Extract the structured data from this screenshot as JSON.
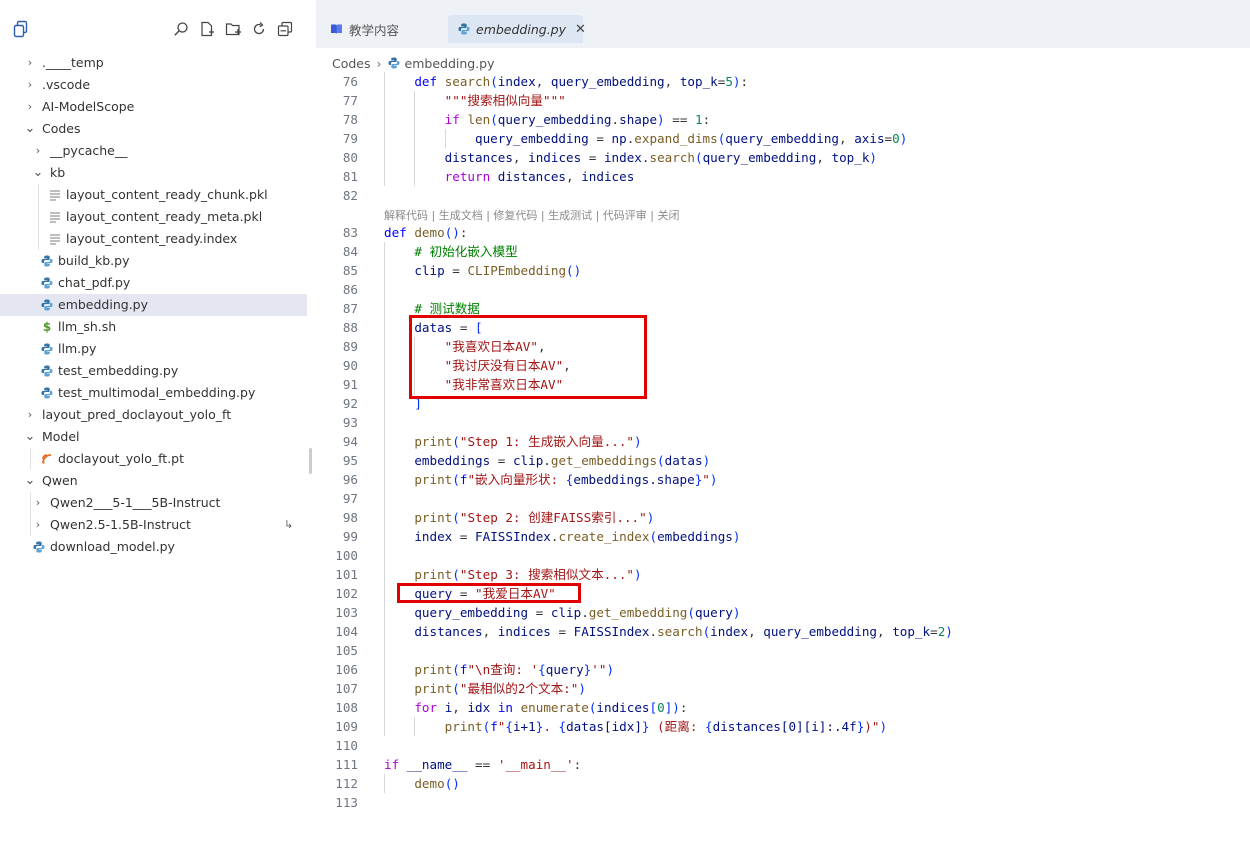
{
  "sidebar": {
    "toolbar": {
      "files_icon": "files-icon",
      "search_icon": "search-icon",
      "new_file_icon": "new-file-icon",
      "new_folder_icon": "new-folder-icon",
      "refresh_icon": "refresh-icon",
      "collapse_icon": "collapse-all-icon"
    },
    "tree": [
      {
        "label": ".____temp",
        "type": "folder",
        "expanded": false,
        "depth": 0
      },
      {
        "label": ".vscode",
        "type": "folder",
        "expanded": false,
        "depth": 0
      },
      {
        "label": "AI-ModelScope",
        "type": "folder",
        "expanded": false,
        "depth": 0
      },
      {
        "label": "Codes",
        "type": "folder",
        "expanded": true,
        "depth": 0
      },
      {
        "label": "__pycache__",
        "type": "folder",
        "expanded": false,
        "depth": 1
      },
      {
        "label": "kb",
        "type": "folder",
        "expanded": true,
        "depth": 1
      },
      {
        "label": "layout_content_ready_chunk.pkl",
        "type": "text-file",
        "depth": 2
      },
      {
        "label": "layout_content_ready_meta.pkl",
        "type": "text-file",
        "depth": 2
      },
      {
        "label": "layout_content_ready.index",
        "type": "text-file",
        "depth": 2
      },
      {
        "label": "build_kb.py",
        "type": "python-file",
        "depth": 1
      },
      {
        "label": "chat_pdf.py",
        "type": "python-file",
        "depth": 1
      },
      {
        "label": "embedding.py",
        "type": "python-file",
        "depth": 1,
        "selected": true
      },
      {
        "label": "llm_sh.sh",
        "type": "shell-file",
        "depth": 1
      },
      {
        "label": "llm.py",
        "type": "python-file",
        "depth": 1
      },
      {
        "label": "test_embedding.py",
        "type": "python-file",
        "depth": 1
      },
      {
        "label": "test_multimodal_embedding.py",
        "type": "python-file",
        "depth": 1
      },
      {
        "label": "layout_pred_doclayout_yolo_ft",
        "type": "folder",
        "expanded": false,
        "depth": 0
      },
      {
        "label": "Model",
        "type": "folder",
        "expanded": true,
        "depth": 0
      },
      {
        "label": "doclayout_yolo_ft.pt",
        "type": "model-file",
        "depth": 1
      },
      {
        "label": "Qwen",
        "type": "folder",
        "expanded": true,
        "depth": 0
      },
      {
        "label": "Qwen2___5-1___5B-Instruct",
        "type": "folder",
        "expanded": false,
        "depth": 1
      },
      {
        "label": "Qwen2.5-1.5B-Instruct",
        "type": "folder",
        "expanded": false,
        "depth": 1,
        "symlink": true
      },
      {
        "label": "download_model.py",
        "type": "python-file",
        "depth": 0
      }
    ]
  },
  "editor": {
    "tabs": [
      {
        "label": "教学内容",
        "icon": "book-icon",
        "active": false
      },
      {
        "label": "embedding.py",
        "icon": "python-icon",
        "active": true,
        "close_icon": "close-icon"
      }
    ],
    "breadcrumb": {
      "folder": "Codes",
      "file": "embedding.py"
    },
    "codelens": "解释代码 | 生成文档 | 修复代码 | 生成测试 | 代码评审 | 关闭",
    "lines": [
      {
        "n": "76",
        "code": "    def search(index, query_embedding, top_k=5):"
      },
      {
        "n": "77",
        "code": "        \"\"\"搜索相似向量\"\"\""
      },
      {
        "n": "78",
        "code": "        if len(query_embedding.shape) == 1:"
      },
      {
        "n": "79",
        "code": "            query_embedding = np.expand_dims(query_embedding, axis=0)"
      },
      {
        "n": "80",
        "code": "        distances, indices = index.search(query_embedding, top_k)"
      },
      {
        "n": "81",
        "code": "        return distances, indices"
      },
      {
        "n": "82",
        "code": ""
      },
      {
        "n": "83",
        "code": "def demo():"
      },
      {
        "n": "84",
        "code": "    # 初始化嵌入模型"
      },
      {
        "n": "85",
        "code": "    clip = CLIPEmbedding()"
      },
      {
        "n": "86",
        "code": ""
      },
      {
        "n": "87",
        "code": "    # 测试数据"
      },
      {
        "n": "88",
        "code": "    datas = ["
      },
      {
        "n": "89",
        "code": "        \"我喜欢日本AV\","
      },
      {
        "n": "90",
        "code": "        \"我讨厌没有日本AV\","
      },
      {
        "n": "91",
        "code": "        \"我非常喜欢日本AV\""
      },
      {
        "n": "92",
        "code": "    ]"
      },
      {
        "n": "93",
        "code": ""
      },
      {
        "n": "94",
        "code": "    print(\"Step 1: 生成嵌入向量...\")"
      },
      {
        "n": "95",
        "code": "    embeddings = clip.get_embeddings(datas)"
      },
      {
        "n": "96",
        "code": "    print(f\"嵌入向量形状: {embeddings.shape}\")"
      },
      {
        "n": "97",
        "code": ""
      },
      {
        "n": "98",
        "code": "    print(\"Step 2: 创建FAISS索引...\")"
      },
      {
        "n": "99",
        "code": "    index = FAISSIndex.create_index(embeddings)"
      },
      {
        "n": "100",
        "code": ""
      },
      {
        "n": "101",
        "code": "    print(\"Step 3: 搜索相似文本...\")"
      },
      {
        "n": "102",
        "code": "    query = \"我爱日本AV\""
      },
      {
        "n": "103",
        "code": "    query_embedding = clip.get_embedding(query)"
      },
      {
        "n": "104",
        "code": "    distances, indices = FAISSIndex.search(index, query_embedding, top_k=2)"
      },
      {
        "n": "105",
        "code": ""
      },
      {
        "n": "106",
        "code": "    print(f\"\\n查询: '{query}'\")"
      },
      {
        "n": "107",
        "code": "    print(\"最相似的2个文本:\")"
      },
      {
        "n": "108",
        "code": "    for i, idx in enumerate(indices[0]):"
      },
      {
        "n": "109",
        "code": "        print(f\"{i+1}. {datas[idx]} (距离: {distances[0][i]:.4f})\")"
      },
      {
        "n": "110",
        "code": ""
      },
      {
        "n": "111",
        "code": "if __name__ == '__main__':"
      },
      {
        "n": "112",
        "code": "    demo()"
      },
      {
        "n": "113",
        "code": ""
      }
    ]
  },
  "colors": {
    "highlight_box": "#e00000",
    "selected_row": "#e4e6f1",
    "keyword": "#0000ff",
    "control_keyword": "#af00db",
    "string": "#a31515",
    "comment": "#008000",
    "function": "#795e26",
    "number": "#098658"
  }
}
